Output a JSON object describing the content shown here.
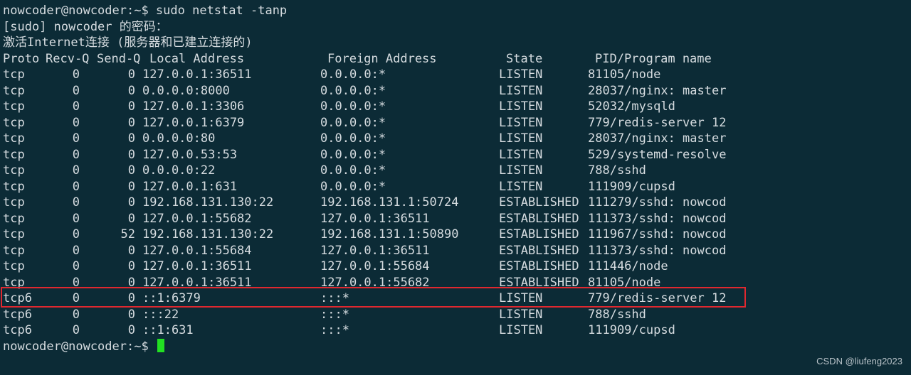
{
  "terminal": {
    "command_line": "nowcoder@nowcoder:~$ sudo netstat -tanp",
    "sudo_prompt": "[sudo] nowcoder 的密码：",
    "section_title": "激活Internet连接 (服务器和已建立连接的)",
    "headers": {
      "proto": "Proto",
      "recvq": "Recv-Q",
      "sendq": "Send-Q",
      "local": "Local Address",
      "foreign": "Foreign Address",
      "state": "State",
      "pid": "PID/Program name"
    },
    "rows": [
      {
        "proto": "tcp",
        "recvq": "0",
        "sendq": "0",
        "local": "127.0.0.1:36511",
        "foreign": "0.0.0.0:*",
        "state": "LISTEN",
        "pid": "81105/node"
      },
      {
        "proto": "tcp",
        "recvq": "0",
        "sendq": "0",
        "local": "0.0.0.0:8000",
        "foreign": "0.0.0.0:*",
        "state": "LISTEN",
        "pid": "28037/nginx: master"
      },
      {
        "proto": "tcp",
        "recvq": "0",
        "sendq": "0",
        "local": "127.0.0.1:3306",
        "foreign": "0.0.0.0:*",
        "state": "LISTEN",
        "pid": "52032/mysqld"
      },
      {
        "proto": "tcp",
        "recvq": "0",
        "sendq": "0",
        "local": "127.0.0.1:6379",
        "foreign": "0.0.0.0:*",
        "state": "LISTEN",
        "pid": "779/redis-server 12"
      },
      {
        "proto": "tcp",
        "recvq": "0",
        "sendq": "0",
        "local": "0.0.0.0:80",
        "foreign": "0.0.0.0:*",
        "state": "LISTEN",
        "pid": "28037/nginx: master"
      },
      {
        "proto": "tcp",
        "recvq": "0",
        "sendq": "0",
        "local": "127.0.0.53:53",
        "foreign": "0.0.0.0:*",
        "state": "LISTEN",
        "pid": "529/systemd-resolve"
      },
      {
        "proto": "tcp",
        "recvq": "0",
        "sendq": "0",
        "local": "0.0.0.0:22",
        "foreign": "0.0.0.0:*",
        "state": "LISTEN",
        "pid": "788/sshd"
      },
      {
        "proto": "tcp",
        "recvq": "0",
        "sendq": "0",
        "local": "127.0.0.1:631",
        "foreign": "0.0.0.0:*",
        "state": "LISTEN",
        "pid": "111909/cupsd"
      },
      {
        "proto": "tcp",
        "recvq": "0",
        "sendq": "0",
        "local": "192.168.131.130:22",
        "foreign": "192.168.131.1:50724",
        "state": "ESTABLISHED",
        "pid": "111279/sshd: nowcod"
      },
      {
        "proto": "tcp",
        "recvq": "0",
        "sendq": "0",
        "local": "127.0.0.1:55682",
        "foreign": "127.0.0.1:36511",
        "state": "ESTABLISHED",
        "pid": "111373/sshd: nowcod"
      },
      {
        "proto": "tcp",
        "recvq": "0",
        "sendq": "52",
        "local": "192.168.131.130:22",
        "foreign": "192.168.131.1:50890",
        "state": "ESTABLISHED",
        "pid": "111967/sshd: nowcod"
      },
      {
        "proto": "tcp",
        "recvq": "0",
        "sendq": "0",
        "local": "127.0.0.1:55684",
        "foreign": "127.0.0.1:36511",
        "state": "ESTABLISHED",
        "pid": "111373/sshd: nowcod"
      },
      {
        "proto": "tcp",
        "recvq": "0",
        "sendq": "0",
        "local": "127.0.0.1:36511",
        "foreign": "127.0.0.1:55684",
        "state": "ESTABLISHED",
        "pid": "111446/node"
      },
      {
        "proto": "tcp",
        "recvq": "0",
        "sendq": "0",
        "local": "127.0.0.1:36511",
        "foreign": "127.0.0.1:55682",
        "state": "ESTABLISHED",
        "pid": "81105/node"
      },
      {
        "proto": "tcp6",
        "recvq": "0",
        "sendq": "0",
        "local": "::1:6379",
        "foreign": ":::*",
        "state": "LISTEN",
        "pid": "779/redis-server 12"
      },
      {
        "proto": "tcp6",
        "recvq": "0",
        "sendq": "0",
        "local": ":::22",
        "foreign": ":::*",
        "state": "LISTEN",
        "pid": "788/sshd"
      },
      {
        "proto": "tcp6",
        "recvq": "0",
        "sendq": "0",
        "local": "::1:631",
        "foreign": ":::*",
        "state": "LISTEN",
        "pid": "111909/cupsd"
      }
    ],
    "final_prompt": "nowcoder@nowcoder:~$ ",
    "colors": {
      "background": "#0c2b36",
      "text": "#d6dce0",
      "cursor": "#22e022",
      "highlight_border": "#e0282f"
    }
  },
  "watermark": "CSDN @liufeng2023"
}
